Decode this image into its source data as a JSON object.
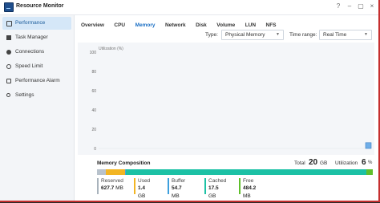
{
  "window": {
    "title": "Resource Monitor",
    "controls": {
      "help": "?",
      "minimize": "–",
      "maximize": "▢",
      "close": "×"
    }
  },
  "sidebar": {
    "items": [
      {
        "label": "Performance",
        "icon": "performance-icon",
        "active": true
      },
      {
        "label": "Task Manager",
        "icon": "task-manager-icon",
        "active": false
      },
      {
        "label": "Connections",
        "icon": "connections-icon",
        "active": false
      },
      {
        "label": "Speed Limit",
        "icon": "speed-limit-icon",
        "active": false
      },
      {
        "label": "Performance Alarm",
        "icon": "alarm-icon",
        "active": false
      },
      {
        "label": "Settings",
        "icon": "settings-icon",
        "active": false
      }
    ]
  },
  "tabs": [
    "Overview",
    "CPU",
    "Memory",
    "Network",
    "Disk",
    "Volume",
    "LUN",
    "NFS"
  ],
  "active_tab": "Memory",
  "filters": {
    "type_label": "Type:",
    "type_value": "Physical Memory",
    "range_label": "Time range:",
    "range_value": "Real Time"
  },
  "chart_data": {
    "type": "area",
    "ylabel": "Utilization (%)",
    "ylim": [
      0,
      100
    ],
    "yticks": [
      "100",
      "80",
      "60",
      "40",
      "20",
      "0"
    ],
    "series": [
      {
        "name": "",
        "values": [
          6
        ]
      }
    ],
    "fill_color": "#6faee8",
    "grid": false
  },
  "composition": {
    "title": "Memory Composition",
    "total_label": "Total",
    "total_value": "20",
    "total_unit": "GB",
    "util_label": "Utilization",
    "util_value": "6",
    "util_unit": "%",
    "segments": [
      {
        "name": "Reserved",
        "fraction": 0.031,
        "color": "#b8c2cc"
      },
      {
        "name": "Used",
        "fraction": 0.07,
        "color": "#f2b523"
      },
      {
        "name": "Buffer",
        "fraction": 0.005,
        "color": "#4aa3df"
      },
      {
        "name": "Cached",
        "fraction": 0.875,
        "color": "#1cc1a5"
      },
      {
        "name": "Free",
        "fraction": 0.024,
        "color": "#5fbf2b"
      }
    ],
    "legend": [
      {
        "label": "Reserved",
        "value": "627.7",
        "unit": "MB",
        "color": "#a9b3bc"
      },
      {
        "label": "Used",
        "value": "1.4",
        "unit": "GB",
        "color": "#f2b523"
      },
      {
        "label": "Buffer",
        "value": "54.7",
        "unit": "MB",
        "color": "#3c9fdd"
      },
      {
        "label": "Cached",
        "value": "17.5",
        "unit": "GB",
        "color": "#1cc1a5"
      },
      {
        "label": "Free",
        "value": "484.2",
        "unit": "MB",
        "color": "#5fbf2b"
      }
    ]
  }
}
